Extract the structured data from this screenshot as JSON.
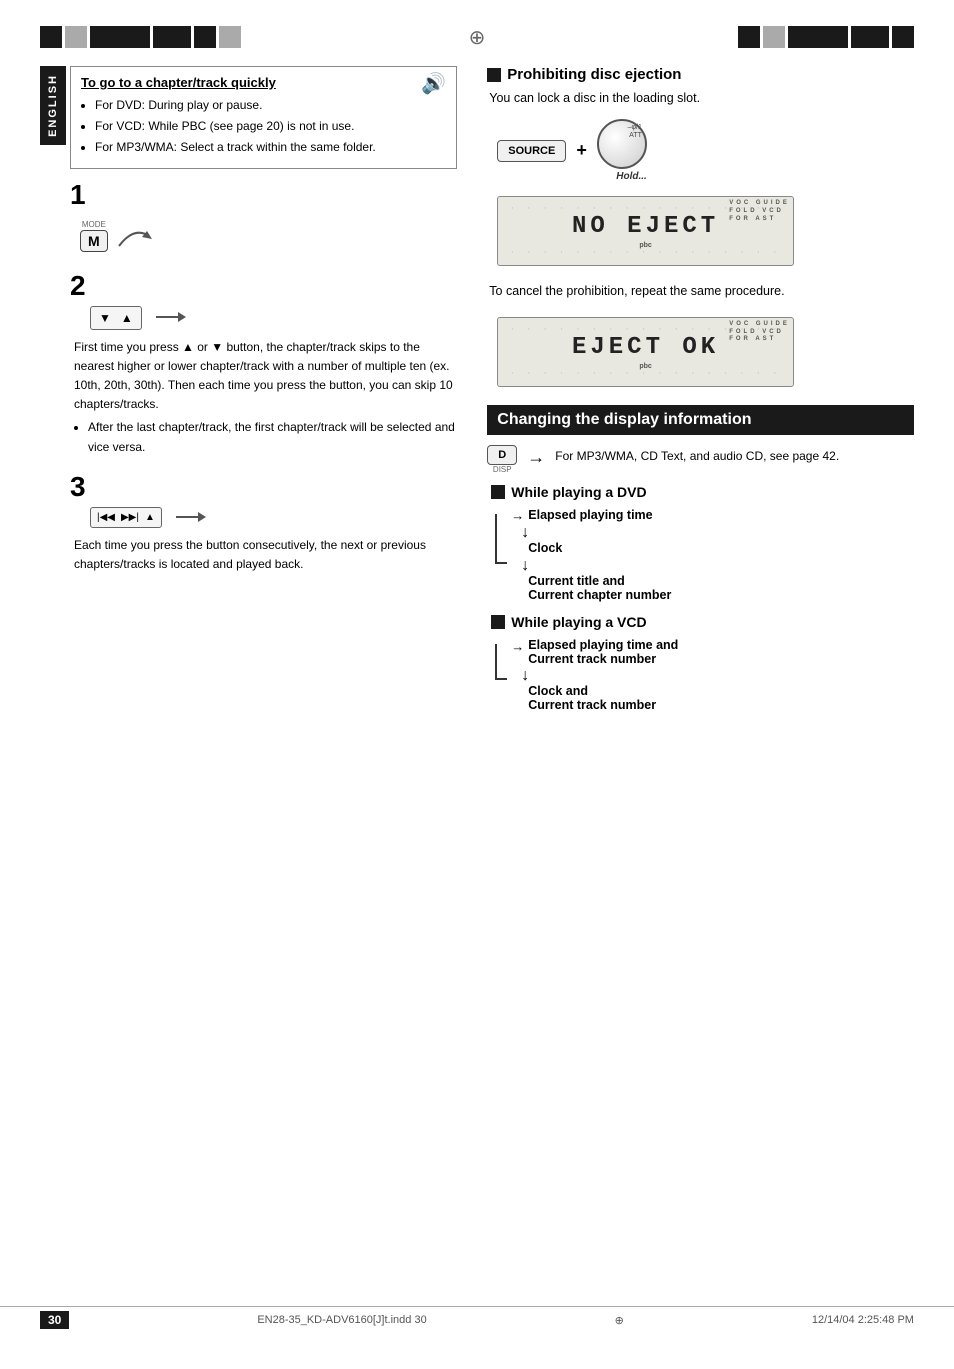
{
  "page": {
    "number": "30",
    "file_info": "EN28-35_KD-ADV6160[J]t.indd  30",
    "date_info": "12/14/04  2:25:48 PM",
    "crosshair_symbol": "⊕"
  },
  "sidebar": {
    "label": "ENGLISH"
  },
  "left_section": {
    "title": "To go to a chapter/track quickly",
    "bullets": [
      "For DVD: During play or pause.",
      "For VCD: While PBC (see page 20) is not in use.",
      "For MP3/WMA: Select a track within the same folder."
    ],
    "step1": {
      "num": "1",
      "btn_label": "MODE",
      "btn_letter": "M"
    },
    "step2": {
      "num": "2",
      "arrow_up": "▲",
      "arrow_down": "▼",
      "description": "First time you press ▲ or ▼ button, the chapter/track skips to the nearest higher or lower chapter/track with a number of multiple ten (ex. 10th, 20th, 30th). Then each time you press the button, you can skip 10 chapters/tracks.",
      "bullet": "After the last chapter/track, the first chapter/track will be selected and vice versa."
    },
    "step3": {
      "num": "3",
      "description": "Each time you press the button consecutively, the next or previous chapters/tracks is located and played back."
    }
  },
  "right_section": {
    "prohibit_title": "Prohibiting disc ejection",
    "prohibit_desc": "You can lock a disc in the loading slot.",
    "source_btn": "SOURCE",
    "knob_label": "–φ/1\nATT",
    "hold_label": "Hold...",
    "lcd1_text": "NO EJECT",
    "lcd1_subtext": "pbc",
    "lcd2_text": "EJECT OK",
    "lcd2_subtext": "pbc",
    "cancel_text": "To cancel the prohibition, repeat the same procedure.",
    "changing_display_title": "Changing the display information",
    "disp_btn": "D",
    "disp_label": "DISP",
    "disp_note": "For MP3/WMA, CD Text, and audio CD, see page 42.",
    "dvd_section": {
      "title": "While playing a DVD",
      "flow": [
        "Elapsed playing time",
        "Clock",
        "Current title and\nCurrent chapter number"
      ]
    },
    "vcd_section": {
      "title": "While playing a VCD",
      "flow": [
        "Elapsed playing time and\nCurrent track number",
        "Clock and\nCurrent track number"
      ]
    }
  }
}
